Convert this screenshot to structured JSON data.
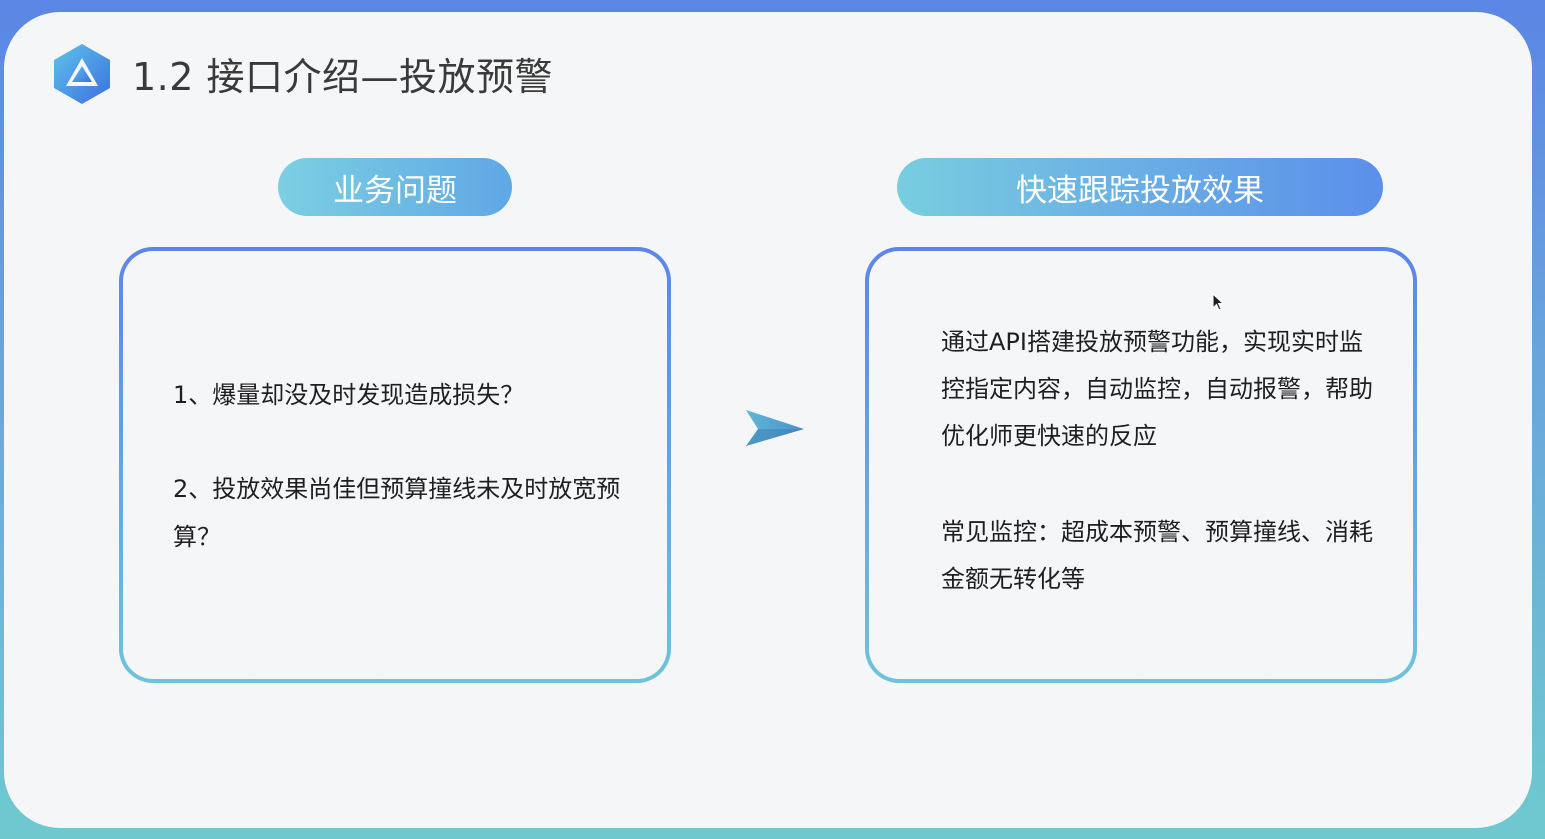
{
  "header": {
    "title": "1.2 接口介绍—投放预警"
  },
  "left": {
    "pill_label": "业务问题",
    "items": [
      "1、爆量却没及时发现造成损失？",
      "2、投放效果尚佳但预算撞线未及时放宽预算？"
    ]
  },
  "right": {
    "pill_label": "快速跟踪投放效果",
    "paragraphs": [
      "通过API搭建投放预警功能，实现实时监控指定内容，自动监控，自动报警，帮助优化师更快速的反应",
      "常见监控：超成本预警、预算撞线、消耗金额无转化等"
    ]
  },
  "colors": {
    "accent_blue": "#5b86e5",
    "accent_teal": "#6fc9cf",
    "text": "#1f1f1f"
  },
  "icons": {
    "logo": "triangle-logo-icon",
    "arrow": "paper-plane-arrow-icon",
    "cursor": "mouse-cursor-icon"
  }
}
